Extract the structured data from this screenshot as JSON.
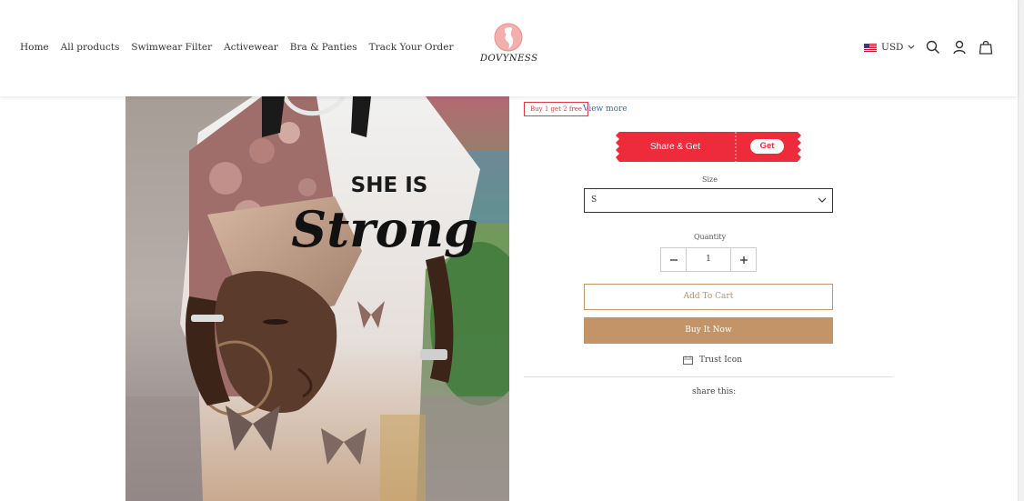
{
  "header": {
    "nav": [
      "Home",
      "All products",
      "Swimwear Filter",
      "Activewear",
      "Bra & Panties",
      "Track Your Order"
    ],
    "brand": "DOVYNESS",
    "currency": "USD",
    "icons": [
      "search-icon",
      "account-icon",
      "cart-bag-icon"
    ]
  },
  "product": {
    "image_alt": "Printed t-shirt dress",
    "image_text_line1": "SHE IS",
    "image_text_line2": "Strong"
  },
  "promo": {
    "badge": "Buy 1 get 2 free",
    "view_more": "View more",
    "share_text": "Share & Get",
    "get_label": "Get",
    "banner_color": "#ee2b3a"
  },
  "size": {
    "label": "Size",
    "selected": "S"
  },
  "quantity": {
    "label": "Quantity",
    "value": "1"
  },
  "actions": {
    "add_to_cart": "Add To Cart",
    "buy_now": "Buy It Now",
    "accent_color": "#c49469"
  },
  "trust": {
    "label": "Trust Icon"
  },
  "share": {
    "label": "share this:"
  }
}
